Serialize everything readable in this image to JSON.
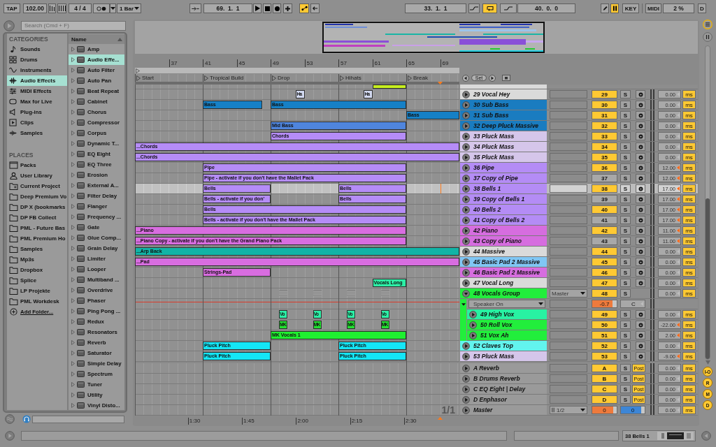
{
  "transport": {
    "tap": "TAP",
    "tempo": "102.00",
    "signature": "4 / 4",
    "metronome": {
      "on": false
    },
    "quantization": "1 Bar",
    "follow": {
      "on": false
    },
    "position": "69.  1.  1",
    "automation_arm": {
      "on": true
    },
    "loop_start": "33.  1.  1",
    "loop": {
      "on": true
    },
    "loop_length": "40.  0.  0",
    "draw_mode": {
      "on": false
    },
    "computer_keys": {
      "on": true
    },
    "key_map": "KEY",
    "midi_map": "MIDI",
    "cpu": "2 %",
    "disk": "D"
  },
  "browser": {
    "search": {
      "placeholder": "Search (Cmd + F)"
    },
    "categories_title": "CATEGORIES",
    "categories": [
      {
        "label": "Sounds",
        "kind": "sounds",
        "selected": false
      },
      {
        "label": "Drums",
        "kind": "drums",
        "selected": false
      },
      {
        "label": "Instruments",
        "kind": "instruments",
        "selected": false
      },
      {
        "label": "Audio Effects",
        "kind": "audio",
        "selected": true
      },
      {
        "label": "MIDI Effects",
        "kind": "midi",
        "selected": false
      },
      {
        "label": "Max for Live",
        "kind": "max",
        "selected": false
      },
      {
        "label": "Plug-ins",
        "kind": "plugins",
        "selected": false
      },
      {
        "label": "Clips",
        "kind": "clips",
        "selected": false
      },
      {
        "label": "Samples",
        "kind": "samples",
        "selected": false
      }
    ],
    "places_title": "PLACES",
    "places": [
      {
        "label": "Packs",
        "kind": "packs",
        "selected": false
      },
      {
        "label": "User Library",
        "kind": "library",
        "selected": false
      },
      {
        "label": "Current Project",
        "kind": "project",
        "selected": false
      },
      {
        "label": "Deep Premium Vo",
        "kind": "folder",
        "selected": false
      },
      {
        "label": "DP X (bookmarks",
        "kind": "folder",
        "selected": false
      },
      {
        "label": "DP FB Collect",
        "kind": "folder",
        "selected": false
      },
      {
        "label": "PML - Future Bas",
        "kind": "folder",
        "selected": false
      },
      {
        "label": "PML Premium Ho",
        "kind": "folder",
        "selected": false
      },
      {
        "label": "Samples",
        "kind": "folder",
        "selected": false
      },
      {
        "label": "Mp3s",
        "kind": "folder",
        "selected": false
      },
      {
        "label": "Dropbox",
        "kind": "folder",
        "selected": false
      },
      {
        "label": "Splice",
        "kind": "folder",
        "selected": false
      },
      {
        "label": "LP Projekte",
        "kind": "folder",
        "selected": false
      },
      {
        "label": "PML Workdesk",
        "kind": "folder",
        "selected": false
      },
      {
        "label": "Add Folder...",
        "kind": "add",
        "selected": false
      }
    ],
    "list_header": "Name",
    "items": [
      {
        "label": "Amp",
        "selected": false
      },
      {
        "label": "Audio Effe...",
        "selected": true
      },
      {
        "label": "Auto Filter",
        "selected": false
      },
      {
        "label": "Auto Pan",
        "selected": false
      },
      {
        "label": "Beat Repeat",
        "selected": false
      },
      {
        "label": "Cabinet",
        "selected": false
      },
      {
        "label": "Chorus",
        "selected": false
      },
      {
        "label": "Compressor",
        "selected": false
      },
      {
        "label": "Corpus",
        "selected": false
      },
      {
        "label": "Dynamic T...",
        "selected": false
      },
      {
        "label": "EQ Eight",
        "selected": false
      },
      {
        "label": "EQ Three",
        "selected": false
      },
      {
        "label": "Erosion",
        "selected": false
      },
      {
        "label": "External A...",
        "selected": false
      },
      {
        "label": "Filter Delay",
        "selected": false
      },
      {
        "label": "Flanger",
        "selected": false
      },
      {
        "label": "Frequency ...",
        "selected": false
      },
      {
        "label": "Gate",
        "selected": false
      },
      {
        "label": "Glue Comp...",
        "selected": false
      },
      {
        "label": "Grain Delay",
        "selected": false
      },
      {
        "label": "Limiter",
        "selected": false
      },
      {
        "label": "Looper",
        "selected": false
      },
      {
        "label": "Multiband ...",
        "selected": false
      },
      {
        "label": "Overdrive",
        "selected": false
      },
      {
        "label": "Phaser",
        "selected": false
      },
      {
        "label": "Ping Pong ...",
        "selected": false
      },
      {
        "label": "Redux",
        "selected": false
      },
      {
        "label": "Resonators",
        "selected": false
      },
      {
        "label": "Reverb",
        "selected": false
      },
      {
        "label": "Saturator",
        "selected": false
      },
      {
        "label": "Simple Delay",
        "selected": false
      },
      {
        "label": "Spectrum",
        "selected": false
      },
      {
        "label": "Tuner",
        "selected": false
      },
      {
        "label": "Utility",
        "selected": false
      },
      {
        "label": "Vinyl Disto...",
        "selected": false
      }
    ]
  },
  "arrangement": {
    "ruler": [
      "37",
      "41",
      "45",
      "49",
      "53",
      "57",
      "61",
      "65",
      "69"
    ],
    "locators": [
      {
        "label": "Start"
      },
      {
        "label": "Tropical Build"
      },
      {
        "label": "Drop"
      },
      {
        "label": "Hihats"
      },
      {
        "label": "Break"
      }
    ],
    "set_button": "Set",
    "tracks": [
      {
        "kind": "cut",
        "color": "#dadada",
        "clips": [
          {
            "color": "#c6ee1e"
          }
        ]
      },
      {
        "kind": "track",
        "name": "29 Vocal Hey",
        "color": "#dadada",
        "number": "29",
        "on": true,
        "selected": false,
        "solo": "S",
        "delay": "0.00",
        "modified": false,
        "unit": "ms",
        "clips": [
          {
            "label": "Ha",
            "color": "#d2d9f0"
          },
          {
            "label": "Ha",
            "color": "#d2d9f0"
          }
        ]
      },
      {
        "kind": "track",
        "name": "30 Sub Bass",
        "color": "#1a7cc0",
        "number": "30",
        "on": true,
        "selected": false,
        "solo": "S",
        "delay": "0.00",
        "modified": false,
        "unit": "ms",
        "clips": [
          {
            "label": "Bass",
            "color": "#1680c6"
          },
          {
            "label": "Bass",
            "color": "#1680c6"
          }
        ]
      },
      {
        "kind": "track",
        "name": "31 Sub Bass",
        "color": "#1a7cc0",
        "number": "31",
        "on": true,
        "selected": false,
        "solo": "S",
        "delay": "0.00",
        "modified": false,
        "unit": "ms",
        "clips": [
          {
            "label": "Bass",
            "color": "#1680c6"
          }
        ]
      },
      {
        "kind": "track",
        "name": "32 Deep Pluck Massive",
        "color": "#1a7cc0",
        "number": "32",
        "on": true,
        "selected": false,
        "solo": "S",
        "delay": "0.00",
        "modified": false,
        "unit": "ms",
        "clips": [
          {
            "label": "Mid Bass",
            "color": "#4f85dd"
          }
        ]
      },
      {
        "kind": "track",
        "name": "33 Pluck Mass",
        "color": "#d5c6ea",
        "number": "33",
        "on": true,
        "selected": false,
        "solo": "S",
        "delay": "0.00",
        "modified": false,
        "unit": "ms",
        "clips": [
          {
            "label": "Chords",
            "color": "#b58cf7"
          }
        ]
      },
      {
        "kind": "track",
        "name": "34 Pluck Mass",
        "color": "#d5c6ea",
        "number": "34",
        "on": true,
        "selected": false,
        "solo": "S",
        "delay": "0.00",
        "modified": false,
        "unit": "ms",
        "clips": [
          {
            "label": "...Chords",
            "color": "#b58cf7"
          }
        ]
      },
      {
        "kind": "track",
        "name": "35 Pluck Mass",
        "color": "#d5c6ea",
        "number": "35",
        "on": true,
        "selected": false,
        "solo": "S",
        "delay": "0.00",
        "modified": false,
        "unit": "ms",
        "clips": [
          {
            "label": "...Chords",
            "color": "#b58cf7"
          }
        ]
      },
      {
        "kind": "track",
        "name": "36 Pipe",
        "color": "#b48cf5",
        "number": "36",
        "on": true,
        "selected": false,
        "solo": "S",
        "delay": "12.00",
        "modified": true,
        "unit": "ms",
        "clips": [
          {
            "label": "Pipe",
            "color": "#b58cf7"
          }
        ]
      },
      {
        "kind": "track",
        "name": "37 Copy of Pipe",
        "color": "#b48cf5",
        "number": "37",
        "on": false,
        "selected": false,
        "solo": "S",
        "delay": "12.00",
        "modified": true,
        "unit": "ms",
        "clips": [
          {
            "label": "Pipe - activate if you don't have the Mallet Pack",
            "color": "#b58cf7"
          }
        ]
      },
      {
        "kind": "track",
        "name": "38 Bells 1",
        "color": "#b48cf5",
        "number": "38",
        "on": true,
        "selected": true,
        "solo": "S",
        "delay": "17.00",
        "modified": true,
        "unit": "ms",
        "clips": [
          {
            "label": "Bells",
            "color": "#b58cf7"
          },
          {
            "label": "Bells",
            "color": "#b58cf7"
          }
        ]
      },
      {
        "kind": "track",
        "name": "39 Copy of Bells 1",
        "color": "#b48cf5",
        "number": "39",
        "on": false,
        "selected": false,
        "solo": "S",
        "delay": "17.00",
        "modified": true,
        "unit": "ms",
        "clips": [
          {
            "label": "Bells - activate if you don'",
            "color": "#b58cf7"
          },
          {
            "label": "Bells",
            "color": "#b58cf7"
          }
        ]
      },
      {
        "kind": "track",
        "name": "40 Bells 2",
        "color": "#b48cf5",
        "number": "40",
        "on": true,
        "selected": false,
        "solo": "S",
        "delay": "17.00",
        "modified": true,
        "unit": "ms",
        "clips": [
          {
            "label": "Bells",
            "color": "#b58cf7"
          }
        ]
      },
      {
        "kind": "track",
        "name": "41 Copy of Bells 2",
        "color": "#b48cf5",
        "number": "41",
        "on": false,
        "selected": false,
        "solo": "S",
        "delay": "17.00",
        "modified": true,
        "unit": "ms",
        "clips": [
          {
            "label": "Bells - activate if you don't have the Mallet Pack",
            "color": "#b58cf7"
          }
        ]
      },
      {
        "kind": "track",
        "name": "42 Piano",
        "color": "#d66ddf",
        "number": "42",
        "on": true,
        "selected": false,
        "solo": "S",
        "delay": "11.00",
        "modified": true,
        "unit": "ms",
        "clips": [
          {
            "label": "...Piano",
            "color": "#d86de0"
          }
        ]
      },
      {
        "kind": "track",
        "name": "43 Copy of Piano",
        "color": "#d66ddf",
        "number": "43",
        "on": false,
        "selected": false,
        "solo": "S",
        "delay": "11.00",
        "modified": true,
        "unit": "ms",
        "clips": [
          {
            "label": "...Piano Copy - activate if you don't have the Grand Piano Pack",
            "color": "#d86de0"
          }
        ]
      },
      {
        "kind": "track",
        "name": "44 Massive",
        "color": "#dadada",
        "number": "44",
        "on": true,
        "selected": false,
        "solo": "S",
        "delay": "0.00",
        "modified": false,
        "unit": "ms",
        "clips": [
          {
            "label": "...Arp Back",
            "color": "#12b4a6"
          }
        ]
      },
      {
        "kind": "track",
        "name": "45 Basic Pad 2 Massive",
        "color": "#80c6f4",
        "number": "45",
        "on": true,
        "selected": false,
        "solo": "S",
        "delay": "0.00",
        "modified": false,
        "unit": "ms",
        "clips": [
          {
            "label": "...Pad",
            "color": "#d86de0"
          }
        ]
      },
      {
        "kind": "track",
        "name": "46 Basic Pad 2 Massive",
        "color": "#d66ddf",
        "number": "46",
        "on": true,
        "selected": false,
        "solo": "S",
        "delay": "0.00",
        "modified": false,
        "unit": "ms",
        "clips": [
          {
            "label": "Strings-Pad",
            "color": "#d86de0"
          }
        ]
      },
      {
        "kind": "track",
        "name": "47 Vocal Long",
        "color": "#dadada",
        "number": "47",
        "on": true,
        "selected": false,
        "solo": "S",
        "delay": "0.00",
        "modified": false,
        "unit": "ms",
        "clips": [
          {
            "label": "Vocals Long",
            "color": "#2cefa6"
          }
        ]
      },
      {
        "kind": "group",
        "name": "48 Vocals Group",
        "color": "#22ee3c",
        "expanded": true,
        "routing": "Master",
        "number": "48",
        "on": true,
        "selected": false,
        "solo": "S",
        "delay": "0.00",
        "modified": false,
        "unit": "ms",
        "clips": [
          {
            "color": "#a2a2a2"
          },
          {
            "color": "#a2a2a2"
          },
          {
            "color": "#a2a2a2"
          },
          {
            "color": "#a2a2a2"
          }
        ],
        "automation": {
          "parameter": "Speaker On",
          "volume": {
            "value": "-0.7",
            "level": 0.82
          },
          "pan": "C"
        },
        "children": [
          {
            "kind": "track",
            "name": "49 High Vox",
            "color": "#28f2a2",
            "number": "49",
            "on": true,
            "selected": false,
            "solo": "S",
            "delay": "0.00",
            "modified": false,
            "unit": "ms",
            "clips": [
              {
                "label": "Vo",
                "color": "#2cefa6"
              },
              {
                "label": "Vo",
                "color": "#2cefa6"
              },
              {
                "label": "Vo",
                "color": "#2cefa6"
              },
              {
                "label": "Vo",
                "color": "#2cefa6"
              }
            ]
          },
          {
            "kind": "track",
            "name": "50 Roll Vox",
            "color": "#22ee3c",
            "number": "50",
            "on": true,
            "selected": false,
            "solo": "S",
            "delay": "-22.00",
            "modified": true,
            "unit": "ms",
            "clips": [
              {
                "label": "MK",
                "color": "#22e030"
              },
              {
                "label": "MK",
                "color": "#22e030"
              },
              {
                "label": "MK",
                "color": "#22e030"
              },
              {
                "label": "MK",
                "color": "#22e030"
              }
            ]
          },
          {
            "kind": "track",
            "name": "51 Vox Ah",
            "color": "#22ee3c",
            "number": "51",
            "on": true,
            "selected": false,
            "solo": "S",
            "delay": "2.00",
            "modified": true,
            "unit": "ms",
            "clips": [
              {
                "label": "MK Vocals 1",
                "color": "#1ff030"
              }
            ]
          }
        ]
      },
      {
        "kind": "track",
        "name": "52 Claves Top",
        "color": "#62f4ee",
        "number": "52",
        "on": true,
        "selected": false,
        "solo": "S",
        "delay": "0.00",
        "modified": false,
        "unit": "ms",
        "clips": [
          {
            "label": "Pluck Pitch",
            "color": "#14e6f6"
          },
          {
            "label": "Pluck Pitch",
            "color": "#14e6f6"
          }
        ]
      },
      {
        "kind": "track",
        "name": "53 Pluck Mass",
        "color": "#d5c6ea",
        "number": "53",
        "on": true,
        "selected": false,
        "solo": "S",
        "delay": "-9.00",
        "modified": true,
        "unit": "ms",
        "clips": [
          {
            "label": "Pluck Pitch",
            "color": "#14e6f6"
          },
          {
            "label": "Pluck Pitch",
            "color": "#14e6f6"
          }
        ]
      }
    ],
    "returns": [
      {
        "kind": "return",
        "name": "A Reverb",
        "number": "A",
        "on": true,
        "solo": "S",
        "post": "Post",
        "delay": "0.00",
        "modified": false,
        "unit": "ms"
      },
      {
        "kind": "return",
        "name": "B Drums Reverb",
        "number": "B",
        "on": true,
        "solo": "S",
        "post": "Post",
        "delay": "0.00",
        "modified": false,
        "unit": "ms"
      },
      {
        "kind": "return",
        "name": "C EQ Eight | Delay",
        "number": "C",
        "on": true,
        "solo": "S",
        "post": "Post",
        "delay": "0.00",
        "modified": false,
        "unit": "ms"
      },
      {
        "kind": "return",
        "name": "D Enphasor",
        "number": "D",
        "on": true,
        "solo": "S",
        "post": "Post",
        "delay": "0.00",
        "modified": false,
        "unit": "ms"
      },
      {
        "kind": "master",
        "name": "Master",
        "routing": "1/2",
        "volume": {
          "value": "0",
          "level": 0.85
        },
        "cue": {
          "value": "0",
          "level": 0.85
        },
        "delay": "0.00",
        "modified": false,
        "unit": "ms"
      }
    ],
    "page": "1/1",
    "time_ruler": [
      "1:30",
      "1:45",
      "2:00",
      "2:15",
      "2:30"
    ]
  },
  "mixer_toggles": [
    {
      "label": "I-O",
      "on": true
    },
    {
      "label": "R",
      "on": true
    },
    {
      "label": "M",
      "on": true
    },
    {
      "label": "D",
      "on": true
    }
  ],
  "status": {
    "selected_track": "38 Bells 1"
  }
}
